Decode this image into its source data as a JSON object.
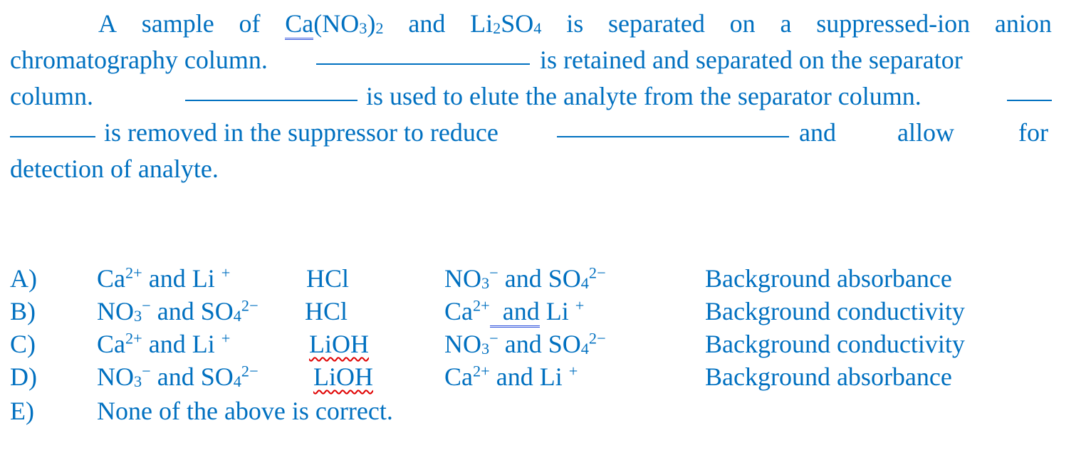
{
  "question": {
    "line1": {
      "w": [
        "A",
        "sample",
        "of"
      ],
      "ca": "Ca",
      "nitrate_rest": "(NO",
      "n3": "3",
      "close": ")",
      "n2": "2",
      "and": "and",
      "li": "Li",
      "li2": "2",
      "so": "SO",
      "s4": "4",
      "rest": [
        "is",
        "separated",
        "on",
        "a",
        "suppressed-ion",
        "anion"
      ]
    },
    "line2": {
      "start": "chromatography column.",
      "end": "is retained and separated on the separator"
    },
    "line3": {
      "start": "column.",
      "end": "is used to elute the analyte from the separator column."
    },
    "line4": {
      "mid": "is removed in the suppressor to reduce",
      "and": "and",
      "allow": "allow",
      "for": "for"
    },
    "line5": "detection of analyte."
  },
  "options": [
    {
      "letter": "A)",
      "col1": "Ca2+ and Li+",
      "col2": "HCl",
      "col3": "NO3− and SO42−",
      "col4": "Background absorbance"
    },
    {
      "letter": "B)",
      "col1": "NO3− and SO42−",
      "col2": "HCl",
      "col3": "Ca2+ and Li+",
      "col4": "Background conductivity"
    },
    {
      "letter": "C)",
      "col1": "Ca2+ and Li+",
      "col2": "LiOH",
      "col3": "NO3− and SO42−",
      "col4": "Background conductivity"
    },
    {
      "letter": "D)",
      "col1": "NO3− and SO42−",
      "col2": "LiOH",
      "col3": "Ca2+ and Li+",
      "col4": "Background absorbance"
    },
    {
      "letter": "E)",
      "col1": "None of the above is correct."
    }
  ],
  "chem": {
    "ca": "Ca",
    "ca_sup": "2+",
    "and": "and",
    "li": "Li",
    "li_sup": "+",
    "no": "NO",
    "no_sub": "3",
    "no_sup": "−",
    "so": "SO",
    "so_sub": "4",
    "so_sup": "2−"
  },
  "colors": {
    "text": "#0070c0",
    "spell_error": "#e00000",
    "grammar_mark": "#3355dd"
  }
}
